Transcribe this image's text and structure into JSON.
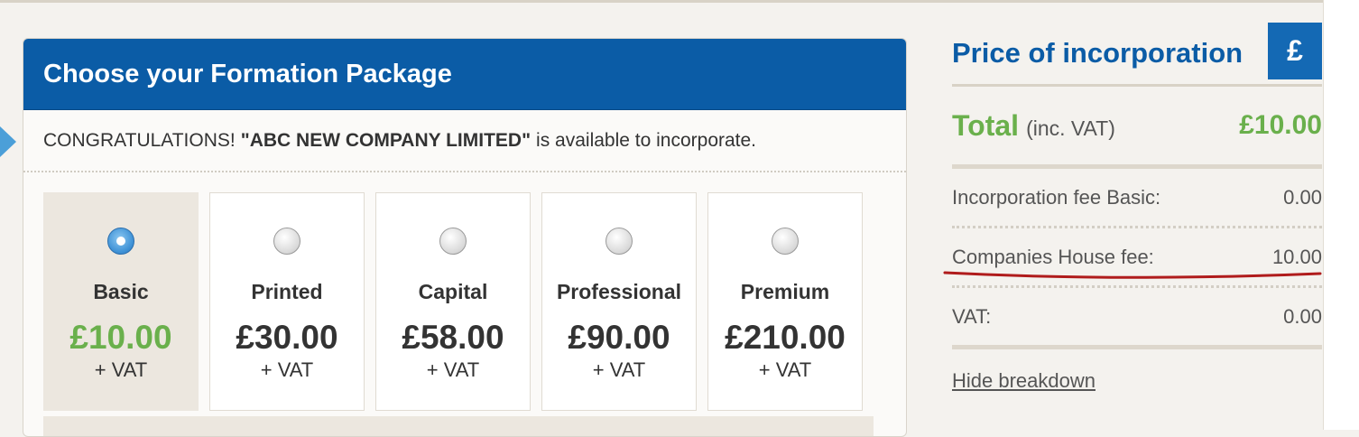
{
  "panel": {
    "title": "Choose your Formation Package",
    "congrats_prefix": "CONGRATULATIONS!",
    "company_name": "\"ABC NEW COMPANY LIMITED\"",
    "congrats_suffix": "is available to incorporate."
  },
  "packages": [
    {
      "name": "Basic",
      "price": "£10.00",
      "vat": "+ VAT",
      "selected": true
    },
    {
      "name": "Printed",
      "price": "£30.00",
      "vat": "+ VAT",
      "selected": false
    },
    {
      "name": "Capital",
      "price": "£58.00",
      "vat": "+ VAT",
      "selected": false
    },
    {
      "name": "Professional",
      "price": "£90.00",
      "vat": "+ VAT",
      "selected": false
    },
    {
      "name": "Premium",
      "price": "£210.00",
      "vat": "+ VAT",
      "selected": false
    }
  ],
  "sidebar": {
    "title": "Price of incorporation",
    "currency_symbol": "£",
    "total_label": "Total",
    "total_sub": "(inc. VAT)",
    "total_value": "£10.00",
    "rows": [
      {
        "label": "Incorporation fee Basic:",
        "value": "0.00"
      },
      {
        "label": "Companies House fee:",
        "value": "10.00"
      },
      {
        "label": "VAT:",
        "value": "0.00"
      }
    ],
    "hide_link": "Hide breakdown"
  },
  "colors": {
    "brand_blue": "#0b5ca6",
    "accent_green": "#6ab04c",
    "annotation_red": "#b01c1c"
  }
}
